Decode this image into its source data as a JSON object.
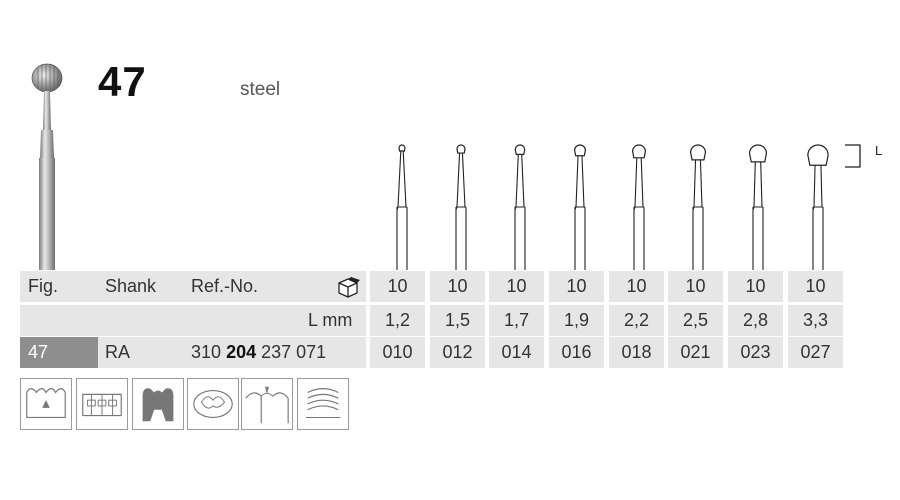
{
  "product": {
    "figure": "47",
    "material": "steel"
  },
  "length_marker": "L",
  "table": {
    "header": {
      "fig_label": "Fig.",
      "shank_label": "Shank",
      "ref_label": "Ref.-No.",
      "packing_icon": "package-icon",
      "pack_units": [
        "10",
        "10",
        "10",
        "10",
        "10",
        "10",
        "10",
        "10"
      ]
    },
    "length_row": {
      "label": "L mm",
      "values": [
        "1,2",
        "1,5",
        "1,7",
        "1,9",
        "2,2",
        "2,5",
        "2,8",
        "3,3"
      ]
    },
    "data_row": {
      "fig": "47",
      "shank": "RA",
      "ref_prefix": "310",
      "ref_bold": "204",
      "ref_suffix": "237 071",
      "sizes": [
        "010",
        "012",
        "014",
        "016",
        "018",
        "021",
        "023",
        "027"
      ]
    }
  },
  "applications": [
    {
      "icon": "cavity-preparation-icon"
    },
    {
      "icon": "crown-removal-icon"
    },
    {
      "icon": "tooth-section-icon"
    },
    {
      "icon": "caries-excavation-icon"
    },
    {
      "icon": "root-canal-icon"
    },
    {
      "icon": "finishing-icon"
    }
  ],
  "colors": {
    "cell_bg": "#e6e6e6",
    "fig_cell_bg": "#8e8e8e",
    "text": "#333333"
  }
}
